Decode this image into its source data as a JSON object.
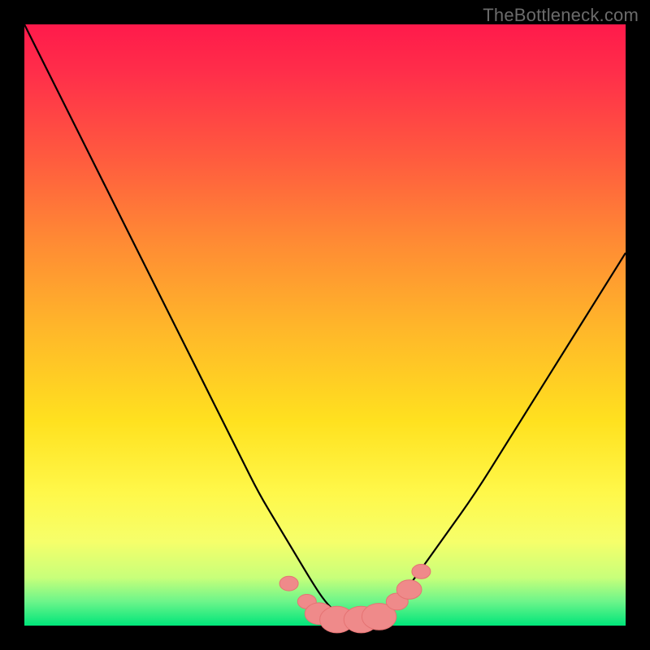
{
  "watermark": {
    "text": "TheBottleneck.com"
  },
  "colors": {
    "gradient_css": "linear-gradient(to bottom, #ff1a4b 0%, #ff2e4a 8%, #ff5a3f 22%, #ff8a34 36%, #ffb52a 50%, #ffe11f 66%, #fff84a 78%, #f6ff6a 86%, #c8ff7a 92%, #6cf58a 96%, #00e57a 100%)",
    "curve_stroke": "#000000",
    "marker_stroke": "#e57373",
    "marker_fill": "#ef8a8a"
  },
  "chart_data": {
    "type": "line",
    "title": "",
    "xlabel": "",
    "ylabel": "",
    "xlim": [
      0,
      100
    ],
    "ylim": [
      0,
      100
    ],
    "grid": false,
    "legend": false,
    "annotations": [
      "TheBottleneck.com"
    ],
    "series": [
      {
        "name": "bottleneck-curve",
        "x": [
          0,
          3,
          6,
          9,
          12,
          15,
          18,
          21,
          24,
          27,
          30,
          33,
          36,
          39,
          42,
          45,
          48,
          50,
          52,
          54,
          56,
          58,
          60,
          62,
          65,
          70,
          75,
          80,
          85,
          90,
          95,
          100
        ],
        "y": [
          100,
          94,
          88,
          82,
          76,
          70,
          64,
          58,
          52,
          46,
          40,
          34,
          28,
          22,
          17,
          12,
          7,
          4,
          2,
          1,
          1,
          1,
          2,
          4,
          8,
          15,
          22,
          30,
          38,
          46,
          54,
          62
        ]
      }
    ],
    "markers": [
      {
        "name": "left-marker-1",
        "x": 44,
        "y": 7,
        "r": 1.2
      },
      {
        "name": "left-marker-2",
        "x": 47,
        "y": 4,
        "r": 1.2
      },
      {
        "name": "left-marker-3",
        "x": 49,
        "y": 2,
        "r": 1.8
      },
      {
        "name": "trough-marker-1",
        "x": 52,
        "y": 1,
        "r": 2.2
      },
      {
        "name": "trough-marker-2",
        "x": 56,
        "y": 1,
        "r": 2.2
      },
      {
        "name": "trough-marker-3",
        "x": 59,
        "y": 1.5,
        "r": 2.2
      },
      {
        "name": "right-marker-1",
        "x": 62,
        "y": 4,
        "r": 1.4
      },
      {
        "name": "right-marker-2",
        "x": 64,
        "y": 6,
        "r": 1.6
      },
      {
        "name": "right-marker-3",
        "x": 66,
        "y": 9,
        "r": 1.2
      }
    ]
  }
}
